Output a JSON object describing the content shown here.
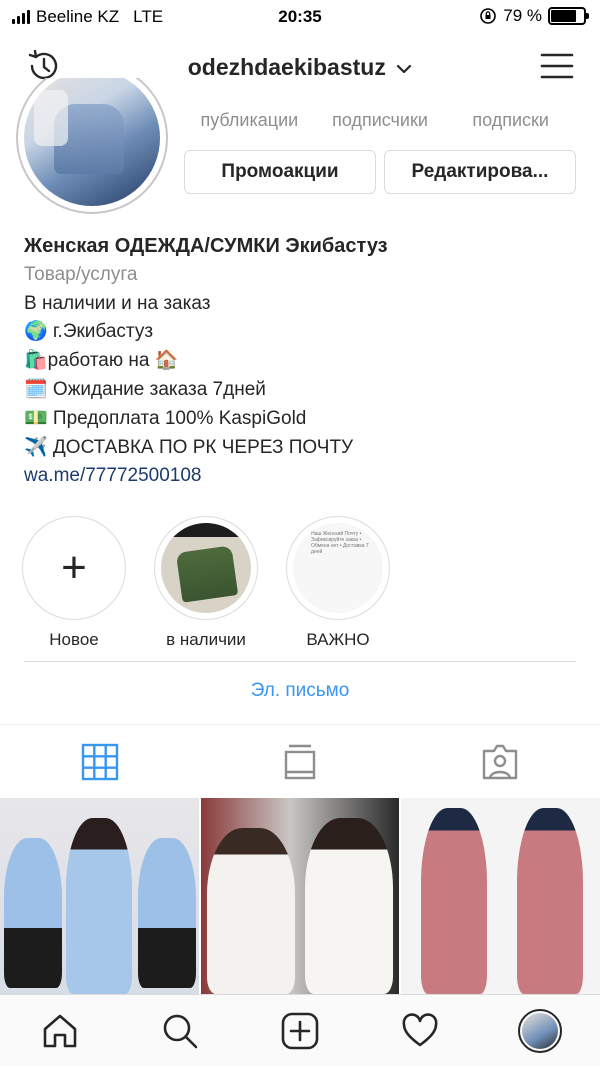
{
  "status_bar": {
    "carrier": "Beeline KZ",
    "network": "LTE",
    "time": "20:35",
    "battery": "79 %",
    "battery_level": 0.79
  },
  "header": {
    "username": "odezhdaekibastuz",
    "history_icon": "history-icon",
    "menu_icon": "hamburger-menu-icon"
  },
  "stats": [
    {
      "label": "публикации"
    },
    {
      "label": "подписчики"
    },
    {
      "label": "подписки"
    }
  ],
  "buttons": {
    "promo": "Промоакции",
    "edit": "Редактирова..."
  },
  "bio": {
    "name": "Женская ОДЕЖДА/СУМКИ Экибастуз",
    "category": "Товар/услуга",
    "lines": [
      "В наличии и на заказ",
      "🌍 г.Экибастуз",
      "🛍️работаю на 🏠",
      "🗓️ Ожидание заказа 7дней",
      "💵 Предоплата 100% KaspiGold",
      "✈️ ДОСТАВКА ПО РК ЧЕРЕЗ ПОЧТУ"
    ],
    "link": "wa.me/77772500108"
  },
  "highlights": [
    {
      "label": "Новое",
      "icon": "plus-icon"
    },
    {
      "label": "в наличии"
    },
    {
      "label": "ВАЖНО",
      "thumb_text": "Наш Женский Почту • Зафиксируйте заказ • Обмена нет • Доставка 7 дней"
    }
  ],
  "contact": {
    "email_label": "Эл. письмо"
  },
  "tabs": [
    {
      "icon": "grid-icon",
      "active": true
    },
    {
      "icon": "feed-icon",
      "active": false
    },
    {
      "icon": "tagged-icon",
      "active": false
    }
  ],
  "bottom_nav": [
    {
      "icon": "home-icon"
    },
    {
      "icon": "search-icon"
    },
    {
      "icon": "new-post-icon"
    },
    {
      "icon": "heart-icon"
    },
    {
      "icon": "profile-avatar"
    }
  ],
  "colors": {
    "link_blue": "#3897f0",
    "bio_link": "#1b3b6f",
    "text": "#262626",
    "secondary": "#8e8e8e"
  }
}
